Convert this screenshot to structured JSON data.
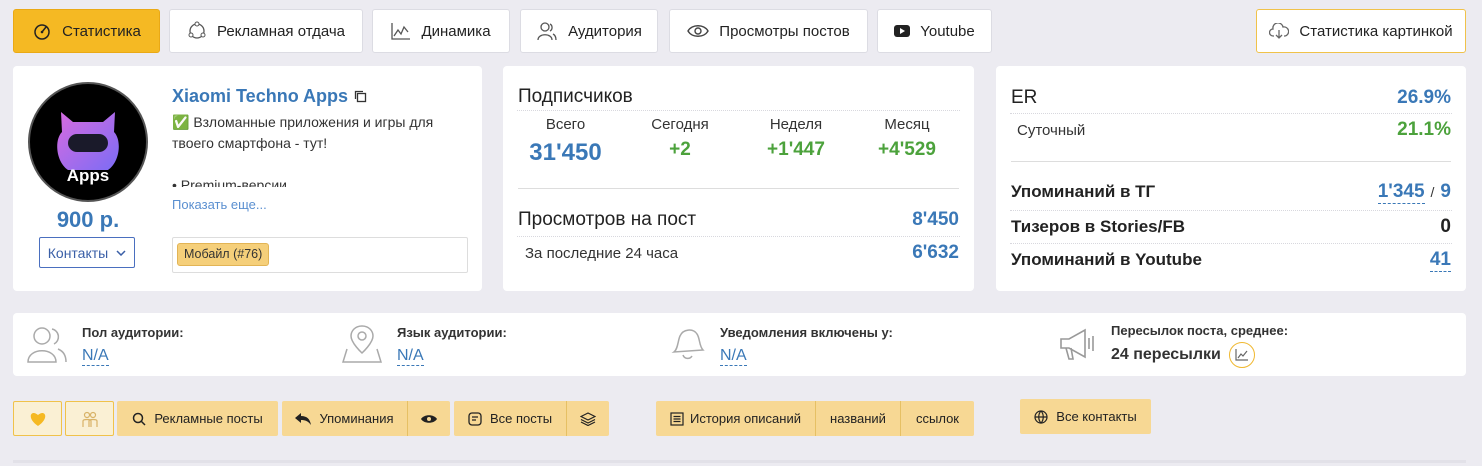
{
  "tabs": [
    {
      "label": "Статистика",
      "icon": "speedometer-icon",
      "active": true
    },
    {
      "label": "Рекламная отдача",
      "icon": "cycle-icon"
    },
    {
      "label": "Динамика",
      "icon": "line-chart-icon"
    },
    {
      "label": "Аудитория",
      "icon": "users-icon"
    },
    {
      "label": "Просмотры постов",
      "icon": "eye-icon"
    },
    {
      "label": "Youtube",
      "icon": "youtube-icon"
    }
  ],
  "image_stats_button": "Статистика картинкой",
  "channel": {
    "name": "Xiaomi Techno Apps",
    "avatar_text": "Apps",
    "description_line1": "✅ Взломанные приложения и игры для",
    "description_line2": "твоего смартфона - тут!",
    "description_line3": "• Premium-версии",
    "show_more": "Показать еще...",
    "price": "900 р.",
    "contacts": "Контакты",
    "category": "Мобайл (#76)"
  },
  "subscribers": {
    "title": "Подписчиков",
    "cols": [
      {
        "label": "Всего",
        "value": "31'450"
      },
      {
        "label": "Сегодня",
        "value": "+2"
      },
      {
        "label": "Неделя",
        "value": "+1'447"
      },
      {
        "label": "Месяц",
        "value": "+4'529"
      }
    ],
    "views_label": "Просмотров на пост",
    "views_value": "8'450",
    "last24_label": "За последние 24 часа",
    "last24_value": "6'632"
  },
  "er": {
    "label": "ER",
    "value": "26.9%",
    "daily_label": "Суточный",
    "daily_value": "21.1%",
    "tg_label": "Упоминаний в ТГ",
    "tg_value": "1'345",
    "tg_slash": "/",
    "tg_value2": "9",
    "stories_label": "Тизеров в Stories/FB",
    "stories_value": "0",
    "yt_label": "Упоминаний в Youtube",
    "yt_value": "41"
  },
  "audience": [
    {
      "label": "Пол аудитории:",
      "value": "N/A",
      "icon": "users-outline-icon"
    },
    {
      "label": "Язык аудитории:",
      "value": "N/A",
      "icon": "map-pin-icon"
    },
    {
      "label": "Уведомления включены у:",
      "value": "N/A",
      "icon": "bell-icon"
    },
    {
      "label": "Пересылок поста, среднее:",
      "value": "24 пересылки",
      "icon": "megaphone-icon"
    }
  ],
  "actions": {
    "ad_posts": "Рекламные посты",
    "mentions": "Упоминания",
    "all_posts": "Все посты",
    "history": "История описаний",
    "names": "названий",
    "links": "ссылок",
    "all_contacts": "Все контакты"
  },
  "colors": {
    "accent": "#f5b923",
    "link": "#3a78b7",
    "positive": "#4ca23c"
  }
}
